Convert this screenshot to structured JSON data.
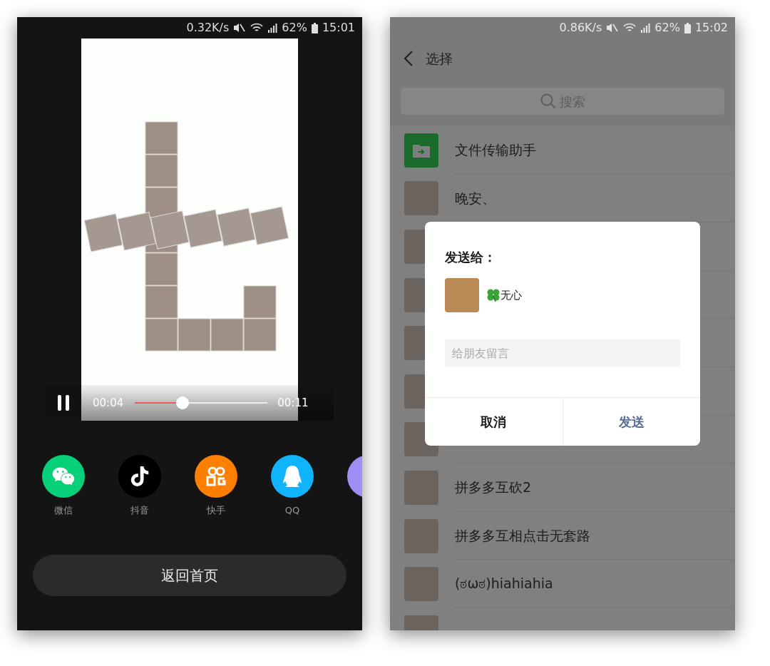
{
  "left_screen": {
    "status_bar": {
      "speed": "0.32K/s",
      "battery": "62%",
      "time": "15:01"
    },
    "video": {
      "playing": true,
      "current_time": "00:04",
      "duration": "00:11",
      "level": 0.36
    },
    "share_targets": [
      {
        "kind": "wechat",
        "label": "微信",
        "color": "#07d07a"
      },
      {
        "kind": "tiktok",
        "label": "抖音",
        "color": "#000000"
      },
      {
        "kind": "kuaishou",
        "label": "快手",
        "color": "#ff7f00"
      },
      {
        "kind": "qq",
        "label": "QQ",
        "color": "#10b4fc"
      },
      {
        "kind": "more",
        "color": "#9c90f7"
      }
    ],
    "home_button": "返回首页"
  },
  "right_screen": {
    "status_bar": {
      "speed": "0.86K/s",
      "battery": "62%",
      "time": "15:02"
    },
    "header": {
      "title": "选择"
    },
    "search": {
      "placeholder": "搜索"
    },
    "contacts": [
      {
        "kind": "file-transfer",
        "name": "文件传输助手"
      },
      {
        "kind": "photo",
        "name": "晚安、"
      },
      {
        "kind": "photo"
      },
      {
        "kind": "photo"
      },
      {
        "kind": "photo"
      },
      {
        "kind": "photo"
      },
      {
        "kind": "photo"
      },
      {
        "kind": "photo",
        "name": "拼多多互砍2"
      },
      {
        "kind": "photo",
        "name": "拼多多互相点击无套路"
      },
      {
        "kind": "photo",
        "name": "(ಠωಠ)hiahiahia"
      },
      {
        "kind": "photo"
      }
    ],
    "dialog": {
      "title": "发送给：",
      "recipient": "无心",
      "message_placeholder": "给朋友留言",
      "buttons": [
        {
          "kind": "cancel",
          "label": "取消"
        },
        {
          "kind": "primary",
          "label": "发送"
        }
      ]
    }
  }
}
